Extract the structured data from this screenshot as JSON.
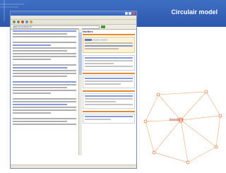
{
  "slide": {
    "title": "Circulair model"
  },
  "browser": {
    "address": "http://enschede.nl/...",
    "panel_title": "Notities"
  },
  "network": {
    "center_label": "lerenfaar",
    "colors": {
      "lines": "#f2b48a",
      "center_fill": "#ffffff",
      "center_stroke": "#e07a3a",
      "node_stroke": "#e07a3a"
    }
  }
}
